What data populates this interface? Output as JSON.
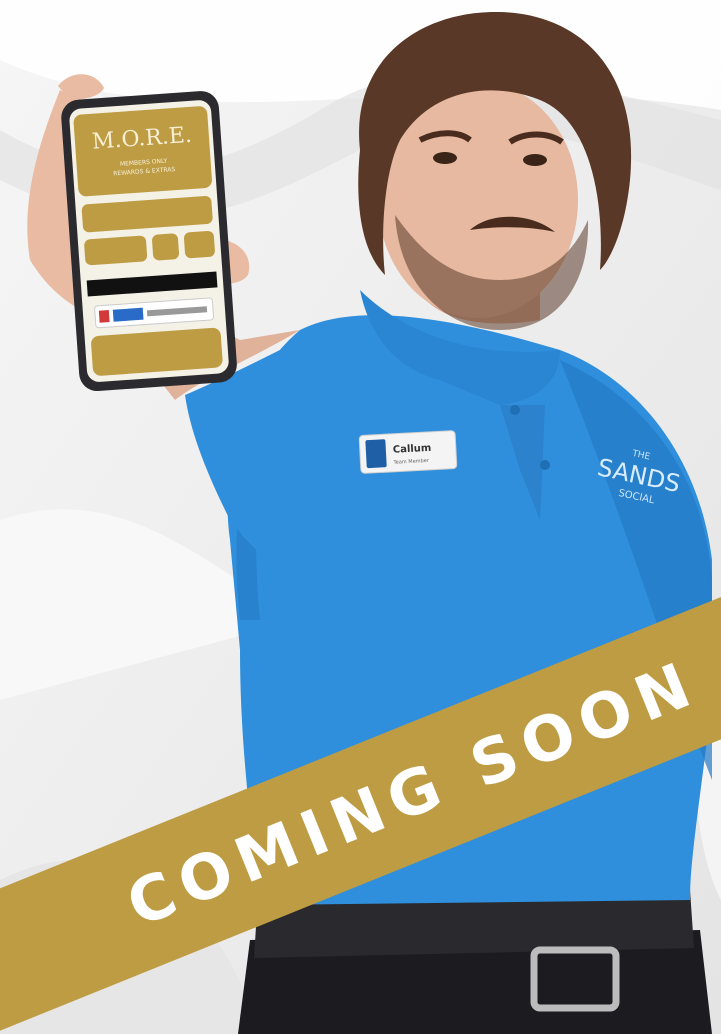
{
  "colors": {
    "gold": "#BD9C43",
    "shirt_blue": "#2f8fdc",
    "background": "#efefef",
    "banner_text": "#ffffff"
  },
  "phone": {
    "app_title": "M.O.R.E.",
    "app_subtitle_line1": "MEMBERS ONLY",
    "app_subtitle_line2": "REWARDS & EXTRAS"
  },
  "name_badge": {
    "name": "Callum",
    "role": "Team Member"
  },
  "shirt_logo": {
    "line1": "THE",
    "line2": "SANDS",
    "line3": "SOCIAL"
  },
  "banner": {
    "text": "COMING SOON"
  }
}
